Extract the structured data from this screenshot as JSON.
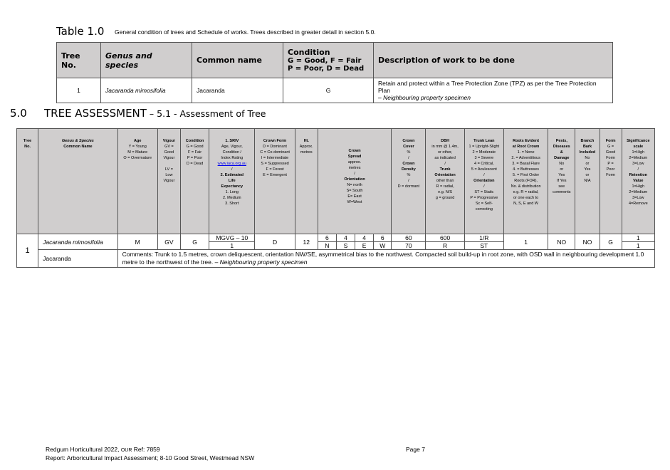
{
  "table1": {
    "label": "Table 1.0",
    "caption": "General condition of trees and Schedule of works. Trees described in greater detail in section 5.0.",
    "headers": {
      "tree_no": "Tree No.",
      "genus": "Genus and species",
      "common": "Common name",
      "condition": "Condition",
      "condition_l1": "G = Good, F = Fair",
      "condition_l2": "P = Poor, D = Dead",
      "work": "Description of work to be done"
    },
    "row": {
      "tree_no": "1",
      "genus": "Jacaranda mimosifolia",
      "common": "Jacaranda",
      "condition": "G",
      "work": "Retain and protect within a Tree Protection Zone (TPZ) as per the Tree Protection Plan",
      "work_note": "– Neighbouring property specimen"
    }
  },
  "section": {
    "number": "5.0",
    "title": "TREE ASSESSMENT",
    "dash": " – ",
    "sub": "5.1 - Assessment of Tree"
  },
  "table2": {
    "headers": {
      "tree_no_1": "Tree",
      "tree_no_2": "No.",
      "genus_1": "Genus & Species",
      "genus_2": "Common Name",
      "age_t": "Age",
      "age_1": "Y = Young",
      "age_2": "M = Mature",
      "age_3": "O = Overmature",
      "vigour_t": "Vigour",
      "vigour_1": "GV =",
      "vigour_2": "Good",
      "vigour_3": "Vigour",
      "vigour_4": "LV =",
      "vigour_5": "Low",
      "vigour_6": "Vigour",
      "cond_t": "Condition",
      "cond_1": "G = Good",
      "cond_2": "F = Fair",
      "cond_3": "P = Poor",
      "cond_4": "D = Dead",
      "sriv_t": "1. SRIV",
      "sriv_1": "Age, Vigour,",
      "sriv_2": "Condition /",
      "sriv_3": "Index Rating",
      "sriv_link": "www.iaca.org.au",
      "sriv_4": "/",
      "sriv_5": "2. Estimated",
      "sriv_6": "Life",
      "sriv_7": "Expectancy",
      "sriv_8": "1. Long",
      "sriv_9": "2. Medium",
      "sriv_10": "3. Short",
      "form_t": "Crown Form",
      "form_1": "D = Dominant",
      "form_2": "C = Co-dominant",
      "form_3": "I = Intermediate",
      "form_4": "S = Suppressed",
      "form_5": "F = Forest",
      "form_6": "E = Emergent",
      "ht_t": "Ht.",
      "ht_1": "Approx.",
      "ht_2": "metres",
      "spread_t1": "Crown",
      "spread_t2": "Spread",
      "spread_1": "approx.",
      "spread_2": "metres",
      "spread_3": "/",
      "spread_4": "Orientation",
      "spread_5": "N= north",
      "spread_6": "S= South",
      "spread_7": "E= East",
      "spread_8": "W=West",
      "cover_t1": "Crown",
      "cover_t2": "Cover",
      "cover_1": "%",
      "cover_2": "/",
      "cover_t3": "Crown",
      "cover_t4": "Density",
      "cover_3": "%",
      "cover_4": "/",
      "cover_5": "D = dormant",
      "dbh_t": "DBH",
      "dbh_1": "in mm @ 1.4m,",
      "dbh_2": "or other,",
      "dbh_3": "as indicated",
      "dbh_4": "/",
      "dbh_t2": "Trunk",
      "dbh_t3": "Orientation",
      "dbh_5": "other than",
      "dbh_6": "R = radial,",
      "dbh_7": "e.g. N/S",
      "dbh_8": "g = ground",
      "lean_t": "Trunk Lean",
      "lean_1": "1 = Upright-Slight",
      "lean_2": "2 = Moderate",
      "lean_3": "3 = Severe",
      "lean_4": "4 = Critical,",
      "lean_5": "5 = Aculescent",
      "lean_6": "/",
      "lean_t2": "Orientation",
      "lean_7": "/",
      "lean_8": "ST = Static",
      "lean_9": "P = Progressive",
      "lean_10": "Sc = Self-",
      "lean_11": "correcting",
      "roots_t1": "Roots Evident",
      "roots_t2": "at Root Crown",
      "roots_1": "1. = None",
      "roots_2": "2. = Adventitious",
      "roots_3": "3. = Basal Flare",
      "roots_4": "4. = Buttresses",
      "roots_5": "5. = First Order",
      "roots_6": "Roots (FOR),",
      "roots_7": "No. & distribution",
      "roots_8": "e.g. R = radial,",
      "roots_9": "or one each to",
      "roots_10": "N, S, E and W",
      "pests_t1": "Pests,",
      "pests_t2": "Diseases",
      "pests_t3": "&",
      "pests_t4": "Damage",
      "pests_1": "No",
      "pests_2": "or",
      "pests_3": "Yes",
      "pests_4": "If Yes",
      "pests_5": "see",
      "pests_6": "comments",
      "bark_t1": "Branch",
      "bark_t2": "Bark",
      "bark_t3": "Included",
      "bark_1": "No",
      "bark_2": "or",
      "bark_3": "Yes",
      "bark_4": "or",
      "bark_5": "N/A",
      "formq_t": "Form",
      "formq_1": "G =",
      "formq_2": "Good",
      "formq_3": "Form",
      "formq_4": "P =",
      "formq_5": "Poor",
      "formq_6": "Form",
      "sig_t1": "Significance",
      "sig_t2": "scale",
      "sig_1": "1=High",
      "sig_2": "2=Medium",
      "sig_3": "3=Low",
      "sig_4": "/",
      "sig_t3": "Retention",
      "sig_t4": "Value",
      "sig_5": "1=High",
      "sig_6": "2=Medium",
      "sig_7": "3=Low",
      "sig_8": "4=Remove"
    },
    "row": {
      "tree_no": "1",
      "genus": "Jacaranda mimosifolia",
      "common": "Jacaranda",
      "age": "M",
      "vigour": "GV",
      "condition": "G",
      "sriv": "MGVG – 10",
      "life": "1",
      "crown_form": "D",
      "height": "12",
      "spread_values": [
        "6",
        "4",
        "4",
        "6"
      ],
      "spread_dirs": [
        "N",
        "S",
        "E",
        "W"
      ],
      "cover": "60",
      "density": "70",
      "dbh": "600",
      "orientation": "R",
      "lean": "1/R",
      "lean_type": "ST",
      "roots": "1",
      "pests": "NO",
      "bark": "NO",
      "form": "G",
      "significance": "1",
      "retention": "1",
      "comments": "Comments: Trunk to 1.5 metres, crown deliquescent, orientation NW/SE, asymmetrical bias to the northwest. Compacted soil build-up in root zone, with OSD wall in neighbouring development 1.0 metre to the northwest of the tree.",
      "comments_note": "– Neighbouring property specimen"
    }
  },
  "footer": {
    "company": "Redgum Horticultural 2022, ",
    "ref_sc": "Our",
    "ref": " Ref: 7859",
    "page": "Page 7",
    "report": "Report: Arboricultural Impact Assessment; 8-10 Good Street, Westmead NSW"
  }
}
